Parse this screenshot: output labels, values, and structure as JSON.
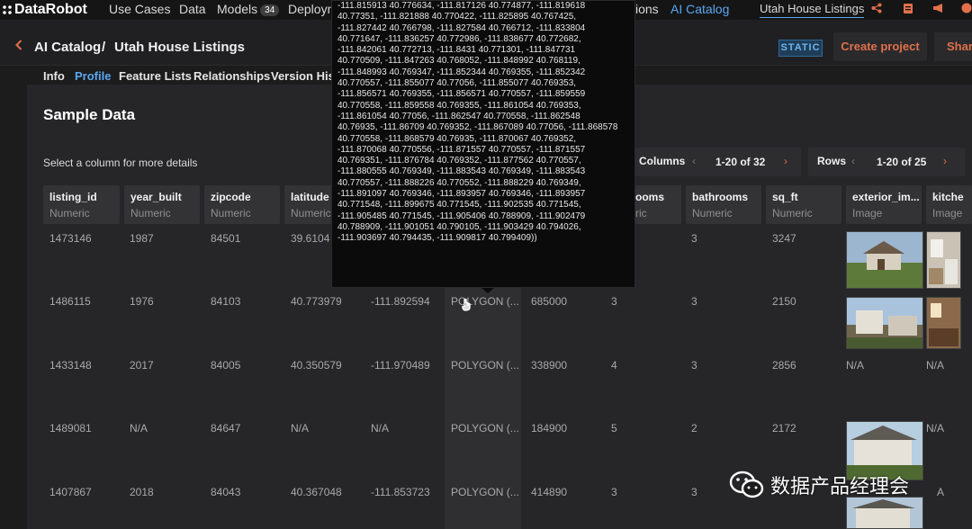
{
  "nav": {
    "brand": "DataRobot",
    "items": [
      "Use Cases",
      "Data",
      "Models",
      "Deployn",
      "ions",
      "AI Catalog"
    ],
    "models_badge": "34",
    "project_name": "Utah House Listings"
  },
  "header": {
    "breadcrumb_root": "AI Catalog",
    "separator": "/",
    "breadcrumb_current": "Utah House Listings",
    "static_badge": "STATIC",
    "create_project": "Create project",
    "share": "Share"
  },
  "tabs": [
    "Info",
    "Profile",
    "Feature Lists",
    "Relationships",
    "Version Hist"
  ],
  "active_tab": "Profile",
  "sample": {
    "title": "Sample Data",
    "hint": "Select a column for more details",
    "columns_pager": {
      "label": "Columns",
      "range": "1-20 of 32"
    },
    "rows_pager": {
      "label": "Rows",
      "range": "1-20 of 25"
    }
  },
  "columns": [
    {
      "name": "listing_id",
      "type": "Numeric"
    },
    {
      "name": "year_built",
      "type": "Numeric"
    },
    {
      "name": "zipcode",
      "type": "Numeric"
    },
    {
      "name": "latitude",
      "type": "Numeric"
    },
    {
      "name": "ooms",
      "type": "ric"
    },
    {
      "name": "bathrooms",
      "type": "Numeric"
    },
    {
      "name": "sq_ft",
      "type": "Numeric"
    },
    {
      "name": "exterior_im...",
      "type": "Image"
    },
    {
      "name": "kitche",
      "type": "Image"
    }
  ],
  "rows": [
    {
      "listing_id": "1473146",
      "year_built": "1987",
      "zipcode": "84501",
      "latitude": "39.6104",
      "longitude": "",
      "polygon": "",
      "price": "",
      "bedrooms": "",
      "bathrooms": "3",
      "sq_ft": "3247",
      "exterior": "",
      "kitchen": ""
    },
    {
      "listing_id": "1486115",
      "year_built": "1976",
      "zipcode": "84103",
      "latitude": "40.773979",
      "longitude": "-111.892594",
      "polygon": "POLYGON (...",
      "price": "685000",
      "bedrooms": "3",
      "bathrooms": "3",
      "sq_ft": "2150",
      "exterior": "",
      "kitchen": ""
    },
    {
      "listing_id": "1433148",
      "year_built": "2017",
      "zipcode": "84005",
      "latitude": "40.350579",
      "longitude": "-111.970489",
      "polygon": "POLYGON (...",
      "price": "338900",
      "bedrooms": "4",
      "bathrooms": "3",
      "sq_ft": "2856",
      "exterior": "N/A",
      "kitchen": "N/A"
    },
    {
      "listing_id": "1489081",
      "year_built": "N/A",
      "zipcode": "84647",
      "latitude": "N/A",
      "longitude": "N/A",
      "polygon": "POLYGON (...",
      "price": "184900",
      "bedrooms": "5",
      "bathrooms": "2",
      "sq_ft": "2172",
      "exterior": "",
      "kitchen": "N/A"
    },
    {
      "listing_id": "1407867",
      "year_built": "2018",
      "zipcode": "84043",
      "latitude": "40.367048",
      "longitude": "-111.853723",
      "polygon": "POLYGON (...",
      "price": "414890",
      "bedrooms": "3",
      "bathrooms": "3",
      "sq_ft": "",
      "exterior": "",
      "kitchen": "A"
    }
  ],
  "tooltip_lines": [
    "-111.815913 40.776634, -111.817126 40.774877, -111.819618",
    "40.77351, -111.821888 40.770422, -111.825895 40.767425,",
    "-111.827442 40.766798, -111.827584 40.766712, -111.833804",
    "40.771647, -111.836257 40.772986, -111.838677 40.772682,",
    "-111.842061 40.772713, -111.8431 40.771301, -111.847731",
    "40.770509, -111.847263 40.768052, -111.848992 40.768119,",
    "-111.848993 40.769347, -111.852344 40.769355, -111.852342",
    "40.770557, -111.855077 40.77056, -111.855077 40.769353,",
    "-111.856571 40.769355, -111.856571 40.770557, -111.859559",
    "40.770558, -111.859558 40.769355, -111.861054 40.769353,",
    "-111.861054 40.77056, -111.862547 40.770558, -111.862548",
    "40.76935, -111.86709 40.769352, -111.867089 40.77056, -111.868578",
    "40.770558, -111.868579 40.76935, -111.870067 40.769352,",
    "-111.870068 40.770556, -111.871557 40.770557, -111.871557",
    "40.769351, -111.876784 40.769352, -111.877562 40.770557,",
    "-111.880555 40.769349, -111.883543 40.769349, -111.883543",
    "40.770557, -111.888226 40.770552, -111.888229 40.769349,",
    "-111.891097 40.769346, -111.893957 40.769346, -111.893957",
    "40.771548, -111.899675 40.771545, -111.902535 40.771545,",
    "-111.905485 40.771545, -111.905406 40.788909, -111.902479",
    "40.788909, -111.901051 40.790105, -111.903429 40.794026,",
    "-111.903697 40.794435, -111.909817 40.799409))"
  ],
  "watermark": "数据产品经理会",
  "colors": {
    "accent": "#e1704b",
    "link": "#5aa7f0",
    "background": "#1c1c1d"
  }
}
